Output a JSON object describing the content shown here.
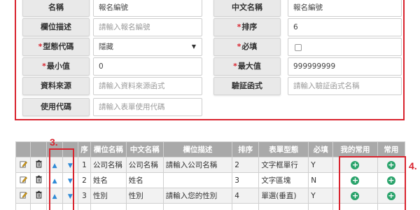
{
  "form": {
    "rows": [
      {
        "label1": "名稱",
        "req1": false,
        "value1": "報名編號",
        "ph1": false,
        "label2": "中文名稱",
        "req2": false,
        "value2": "報名編號",
        "ph2": false
      },
      {
        "label1": "欄位描述",
        "req1": false,
        "value1": "請輸入報名編號",
        "ph1": true,
        "label2": "排序",
        "req2": true,
        "value2": "6",
        "ph2": false
      },
      {
        "label1": "型態代碼",
        "req1": true,
        "value1": "隱藏",
        "ph1": false,
        "label2": "必填",
        "req2": true,
        "value2": "",
        "ph2": false
      },
      {
        "label1": "最小值",
        "req1": true,
        "value1": "0",
        "ph1": false,
        "label2": "最大值",
        "req2": true,
        "value2": "999999999",
        "ph2": false
      },
      {
        "label1": "資料來源",
        "req1": false,
        "value1": "請輸入資料來源函式",
        "ph1": true,
        "label2": "驗証函式",
        "req2": false,
        "value2": "請輸入驗証函式名稱",
        "ph2": true
      },
      {
        "label1": "使用代碼",
        "req1": false,
        "value1": "請輸入表單使用代碼",
        "ph1": true
      }
    ],
    "required_mark": "*"
  },
  "grid": {
    "headers": [
      "",
      "",
      "",
      "",
      "序",
      "欄位名稱",
      "中文名稱",
      "欄位描述",
      "排序",
      "表單型態",
      "必填",
      "我的常用",
      "常用"
    ],
    "rows": [
      {
        "seq": "1",
        "name": "公司名稱",
        "cname": "公司名稱",
        "desc": "請輸入公司名稱",
        "order": "2",
        "type": "文字框單行",
        "required": "Y"
      },
      {
        "seq": "2",
        "name": "姓名",
        "cname": "姓名",
        "desc": "",
        "order": "3",
        "type": "文字區塊",
        "required": "N"
      },
      {
        "seq": "3",
        "name": "性別",
        "cname": "性別",
        "desc": "請輸入您的性別",
        "order": "4",
        "type": "單選(垂直)",
        "required": "Y"
      },
      {
        "seq": "",
        "name": "",
        "cname": "",
        "desc": "",
        "order": "",
        "type": "",
        "required": ""
      }
    ],
    "plus_glyph": "+",
    "up_glyph": "▲",
    "down_glyph": "▼"
  },
  "annotations": {
    "a3": "3.",
    "a4": "4."
  },
  "colors": {
    "accent_red": "#d9232e",
    "header_gray": "#a9a9a9",
    "plus_green": "#2aa36b",
    "arrow_blue": "#2f8ad6"
  },
  "icons": {
    "edit": "edit-icon",
    "delete": "trash-icon",
    "up": "arrow-up-icon",
    "down": "arrow-down-icon",
    "add": "plus-circle-icon"
  }
}
